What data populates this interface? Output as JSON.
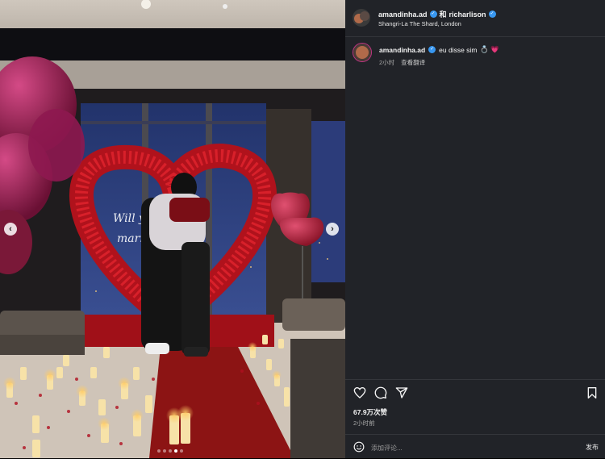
{
  "header": {
    "user1": "amandinha.ad",
    "and_text": "和",
    "user2": "richarlison",
    "location": "Shangri-La The Shard, London"
  },
  "caption": {
    "username": "amandinha.ad",
    "text": "eu disse sim",
    "emojis": "💍 💗",
    "time": "2小时",
    "translate": "查看翻译"
  },
  "stats": {
    "likes": "67.9万次赞",
    "time": "2小时前"
  },
  "comment": {
    "placeholder": "添加评论...",
    "post_label": "发布"
  },
  "carousel": {
    "prev_icon": "chevron-left-icon",
    "next_icon": "chevron-right-icon",
    "dot_count": 5,
    "active_index": 3
  },
  "colors": {
    "panel_bg": "#212328",
    "verified": "#3897f0",
    "heart_emoji": "#ff6b9d"
  }
}
